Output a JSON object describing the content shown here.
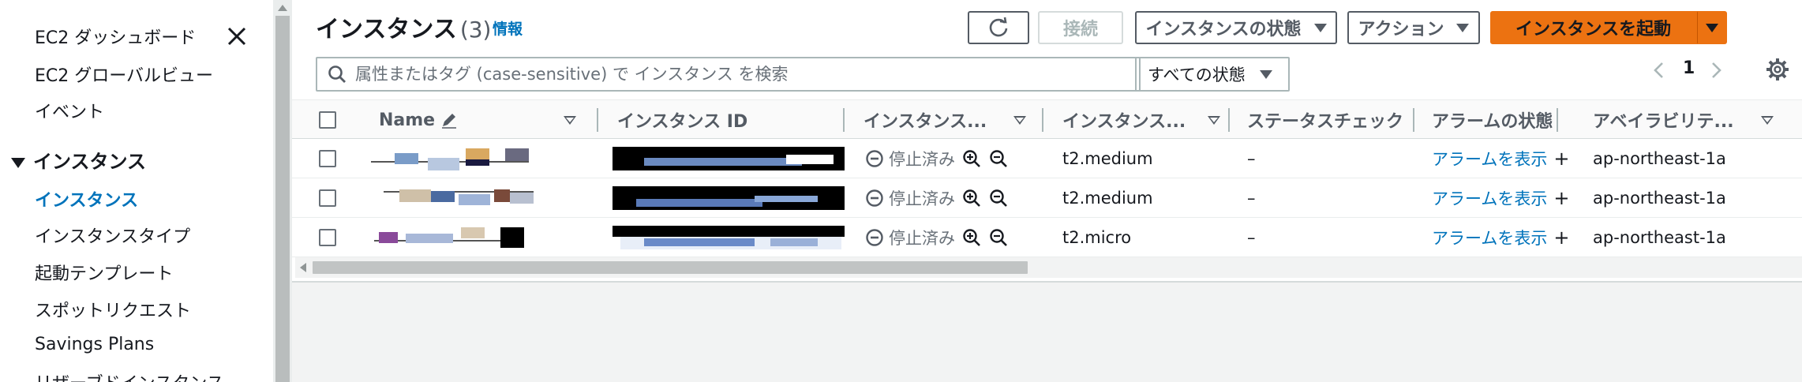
{
  "sidebar": {
    "top_items": [
      "EC2 ダッシュボード",
      "EC2 グローバルビュー",
      "イベント"
    ],
    "section_title": "インスタンス",
    "section_items": [
      {
        "label": "インスタンス",
        "active": true
      },
      {
        "label": "インスタンスタイプ",
        "active": false
      },
      {
        "label": "起動テンプレート",
        "active": false
      },
      {
        "label": "スポットリクエスト",
        "active": false
      },
      {
        "label": "Savings Plans",
        "active": false
      },
      {
        "label": "リザーブドインスタンス",
        "active": false
      }
    ]
  },
  "header": {
    "title": "インスタンス",
    "count": "(3)",
    "info_link": "情報",
    "connect_label": "接続",
    "state_menu_label": "インスタンスの状態",
    "actions_label": "アクション",
    "launch_label": "インスタンスを起動"
  },
  "search": {
    "placeholder": "属性またはタグ (case-sensitive) で インスタンス を検索",
    "value": ""
  },
  "filter": {
    "selected": "すべての状態"
  },
  "pagination": {
    "current_page": "1"
  },
  "table": {
    "columns": [
      "Name",
      "インスタンス ID",
      "インスタンス...",
      "インスタンス...",
      "ステータスチェック",
      "アラームの状態",
      "アベイラビリテ..."
    ],
    "rows": [
      {
        "state": "停止済み",
        "type": "t2.medium",
        "status_check": "–",
        "alarm": "アラームを表示",
        "az": "ap-northeast-1a"
      },
      {
        "state": "停止済み",
        "type": "t2.medium",
        "status_check": "–",
        "alarm": "アラームを表示",
        "az": "ap-northeast-1a"
      },
      {
        "state": "停止済み",
        "type": "t2.micro",
        "status_check": "–",
        "alarm": "アラームを表示",
        "az": "ap-northeast-1a"
      }
    ]
  },
  "colors": {
    "accent": "#0073bb",
    "primary_button": "#ec7211",
    "text": "#16191f",
    "muted": "#545b64"
  },
  "icons": [
    "close-icon",
    "refresh-icon",
    "search-icon",
    "settings-gear-icon",
    "stopped-state-icon",
    "zoom-in-icon",
    "zoom-out-icon",
    "edit-pencil-icon"
  ]
}
